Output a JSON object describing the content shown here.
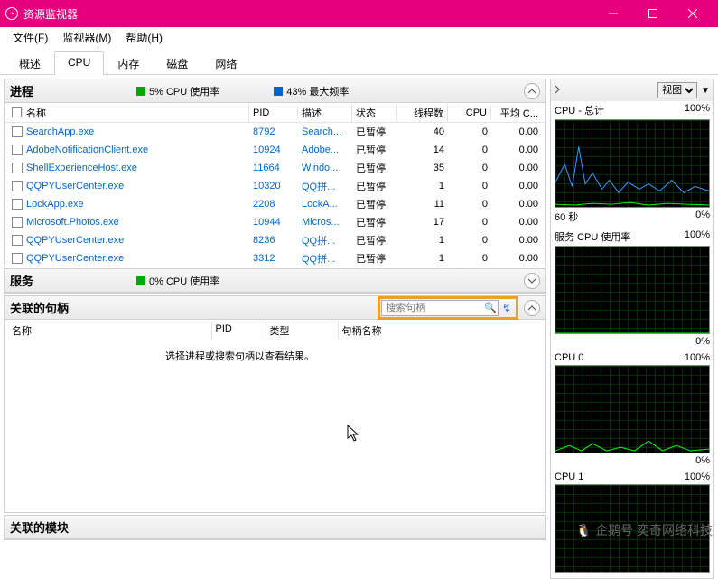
{
  "window": {
    "title": "资源监视器"
  },
  "menu": {
    "file": "文件(F)",
    "monitor": "监视器(M)",
    "help": "帮助(H)"
  },
  "tabs": {
    "overview": "概述",
    "cpu": "CPU",
    "memory": "内存",
    "disk": "磁盘",
    "network": "网络"
  },
  "processes": {
    "title": "进程",
    "cpu_usage_label": "5% CPU 使用率",
    "max_freq_label": "43% 最大频率",
    "cols": {
      "name": "名称",
      "pid": "PID",
      "desc": "描述",
      "status": "状态",
      "threads": "线程数",
      "cpu": "CPU",
      "avg": "平均 C..."
    },
    "rows": [
      {
        "name": "SearchApp.exe",
        "pid": "8792",
        "desc": "Search...",
        "status": "已暂停",
        "threads": "40",
        "cpu": "0",
        "avg": "0.00"
      },
      {
        "name": "AdobeNotificationClient.exe",
        "pid": "10924",
        "desc": "Adobe...",
        "status": "已暂停",
        "threads": "14",
        "cpu": "0",
        "avg": "0.00"
      },
      {
        "name": "ShellExperienceHost.exe",
        "pid": "11664",
        "desc": "Windo...",
        "status": "已暂停",
        "threads": "35",
        "cpu": "0",
        "avg": "0.00"
      },
      {
        "name": "QQPYUserCenter.exe",
        "pid": "10320",
        "desc": "QQ拼...",
        "status": "已暂停",
        "threads": "1",
        "cpu": "0",
        "avg": "0.00"
      },
      {
        "name": "LockApp.exe",
        "pid": "2208",
        "desc": "LockA...",
        "status": "已暂停",
        "threads": "11",
        "cpu": "0",
        "avg": "0.00"
      },
      {
        "name": "Microsoft.Photos.exe",
        "pid": "10944",
        "desc": "Micros...",
        "status": "已暂停",
        "threads": "17",
        "cpu": "0",
        "avg": "0.00"
      },
      {
        "name": "QQPYUserCenter.exe",
        "pid": "8236",
        "desc": "QQ拼...",
        "status": "已暂停",
        "threads": "1",
        "cpu": "0",
        "avg": "0.00"
      },
      {
        "name": "QQPYUserCenter.exe",
        "pid": "3312",
        "desc": "QQ拼...",
        "status": "已暂停",
        "threads": "1",
        "cpu": "0",
        "avg": "0.00"
      }
    ]
  },
  "services": {
    "title": "服务",
    "cpu_usage_label": "0% CPU 使用率"
  },
  "handles": {
    "title": "关联的句柄",
    "search_placeholder": "搜索句柄",
    "cols": {
      "name": "名称",
      "pid": "PID",
      "type": "类型",
      "handle_name": "句柄名称"
    },
    "empty_msg": "选择进程或搜索句柄以查看结果。"
  },
  "modules": {
    "title": "关联的模块"
  },
  "right": {
    "view_label": "视图",
    "graphs": [
      {
        "title": "CPU - 总计",
        "pct": "100%",
        "sub_left": "60 秒",
        "sub_right": "0%"
      },
      {
        "title": "服务 CPU 使用率",
        "pct": "100%",
        "sub_left": "",
        "sub_right": "0%"
      },
      {
        "title": "CPU 0",
        "pct": "100%",
        "sub_left": "",
        "sub_right": "0%"
      },
      {
        "title": "CPU 1",
        "pct": "100%",
        "sub_left": "",
        "sub_right": ""
      }
    ]
  },
  "watermark": "企鹅号 奕奇网络科技"
}
